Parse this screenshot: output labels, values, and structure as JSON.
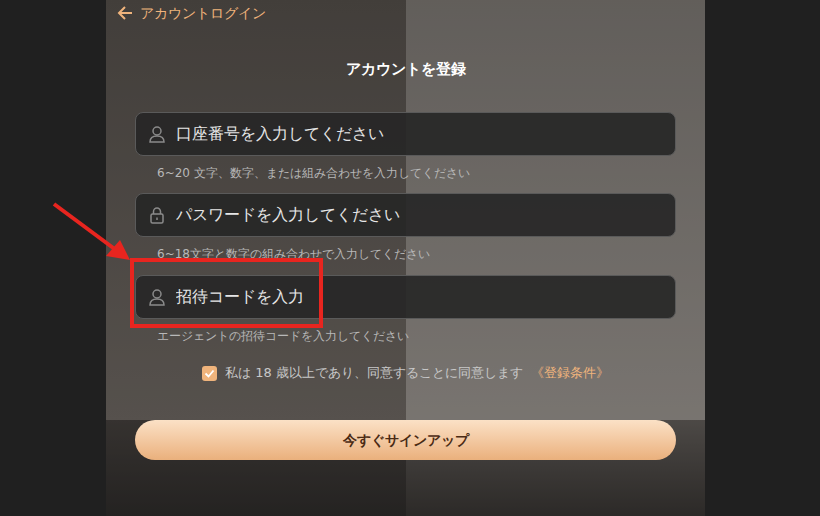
{
  "header": {
    "back_label": "アカウントログイン"
  },
  "title": "アカウントを登録",
  "fields": [
    {
      "kind": "account",
      "placeholder": "口座番号を入力してください",
      "hint": "6~20 文字、数字、または組み合わせを入力してください",
      "highlighted": false
    },
    {
      "kind": "password",
      "placeholder": "パスワードを入力してください",
      "hint": "6~18文字と数字の組み合わせで入力してください",
      "highlighted": false
    },
    {
      "kind": "invite",
      "placeholder": "招待コードを入力",
      "hint": "エージェントの招待コードを入力してください",
      "highlighted": true
    }
  ],
  "agreement": {
    "checked": true,
    "text": "私は 18 歳以上であり、同意することに同意します",
    "link": "《登録条件》"
  },
  "submit_button": "今すぐサインアップ"
}
